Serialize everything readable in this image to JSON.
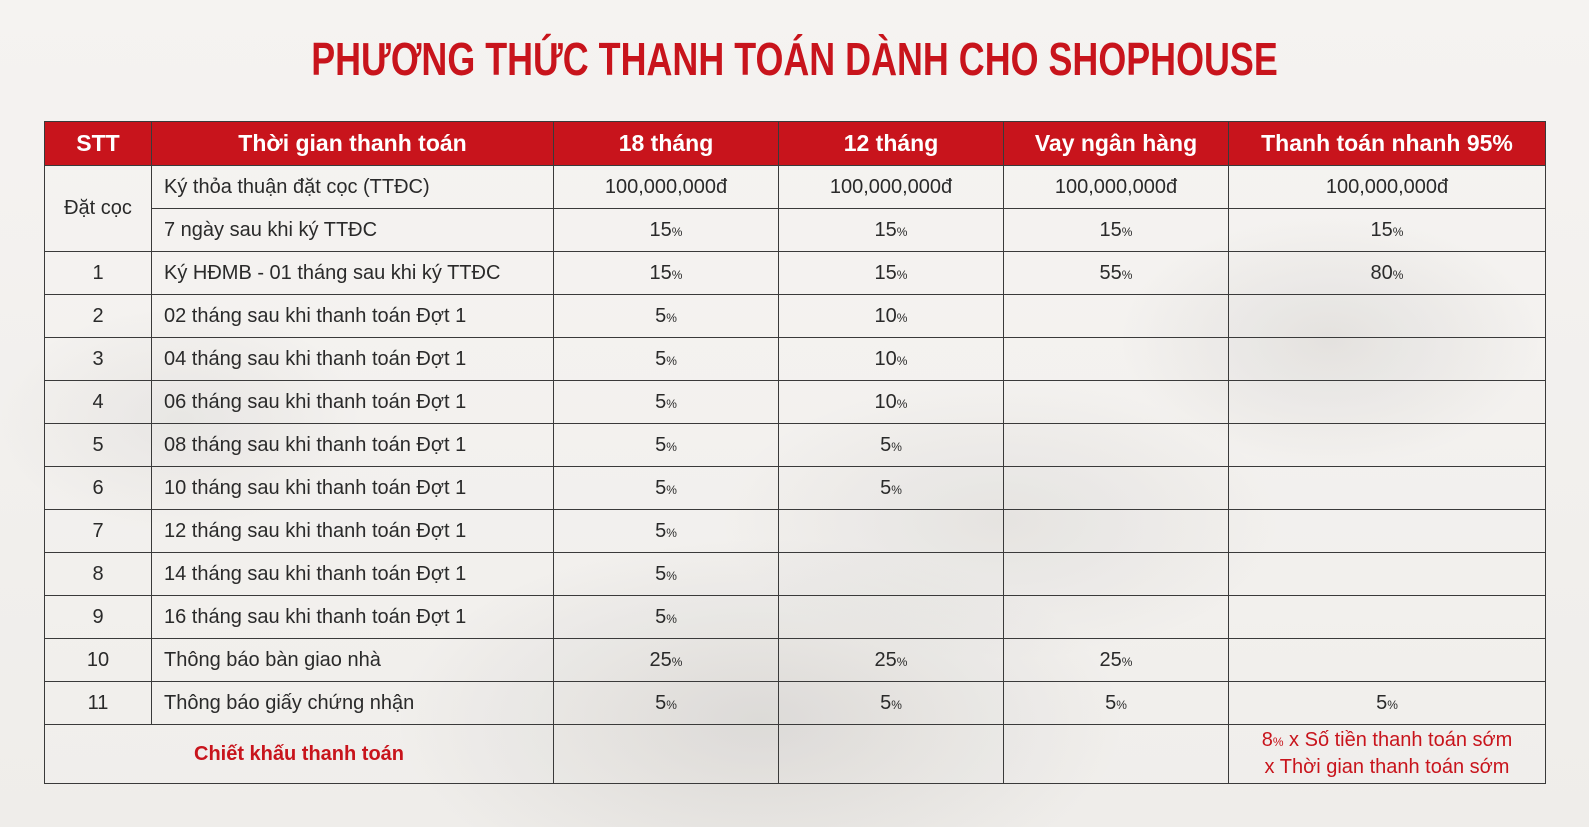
{
  "title": "PHƯƠNG THỨC THANH TOÁN DÀNH CHO SHOPHOUSE",
  "colors": {
    "accent": "#c8141c",
    "border": "#3a3a3a",
    "background": "#f2f0ee"
  },
  "headers": [
    "STT",
    "Thời gian thanh toán",
    "18 tháng",
    "12 tháng",
    "Vay ngân hàng",
    "Thanh toán nhanh 95%"
  ],
  "deposit": {
    "label": "Đặt cọc",
    "rows": [
      {
        "desc": "Ký thỏa thuận đặt cọc (TTĐC)",
        "v18": "100,000,000đ",
        "v12": "100,000,000đ",
        "loan": "100,000,000đ",
        "fast": "100,000,000đ"
      },
      {
        "desc": "7 ngày sau khi ký TTĐC",
        "v18": "15",
        "v12": "15",
        "loan": "15",
        "fast": "15"
      }
    ]
  },
  "rows": [
    {
      "stt": "1",
      "desc": "Ký HĐMB - 01 tháng sau khi ký TTĐC",
      "v18": "15",
      "v12": "15",
      "loan": "55",
      "fast": "80"
    },
    {
      "stt": "2",
      "desc": "02 tháng sau khi thanh toán Đợt 1",
      "v18": "5",
      "v12": "10",
      "loan": "",
      "fast": ""
    },
    {
      "stt": "3",
      "desc": "04 tháng sau khi thanh toán Đợt 1",
      "v18": "5",
      "v12": "10",
      "loan": "",
      "fast": ""
    },
    {
      "stt": "4",
      "desc": "06 tháng sau khi thanh toán Đợt 1",
      "v18": "5",
      "v12": "10",
      "loan": "",
      "fast": ""
    },
    {
      "stt": "5",
      "desc": "08 tháng sau khi thanh toán Đợt 1",
      "v18": "5",
      "v12": "5",
      "loan": "",
      "fast": ""
    },
    {
      "stt": "6",
      "desc": "10 tháng sau khi thanh toán Đợt 1",
      "v18": "5",
      "v12": "5",
      "loan": "",
      "fast": ""
    },
    {
      "stt": "7",
      "desc": "12 tháng sau khi thanh toán Đợt 1",
      "v18": "5",
      "v12": "",
      "loan": "",
      "fast": ""
    },
    {
      "stt": "8",
      "desc": "14 tháng sau khi thanh toán Đợt 1",
      "v18": "5",
      "v12": "",
      "loan": "",
      "fast": ""
    },
    {
      "stt": "9",
      "desc": "16 tháng sau khi thanh toán Đợt 1",
      "v18": "5",
      "v12": "",
      "loan": "",
      "fast": ""
    },
    {
      "stt": "10",
      "desc": "Thông báo bàn giao nhà",
      "v18": "25",
      "v12": "25",
      "loan": "25",
      "fast": ""
    },
    {
      "stt": "11",
      "desc": "Thông báo giấy chứng nhận",
      "v18": "5",
      "v12": "5",
      "loan": "5",
      "fast": "5"
    }
  ],
  "percent_symbol": "%",
  "discount": {
    "label": "Chiết khấu thanh toán",
    "pct_value": "8",
    "line1_rest": " x Số tiền thanh toán sớm",
    "line2": "x Thời gian thanh toán sớm"
  }
}
